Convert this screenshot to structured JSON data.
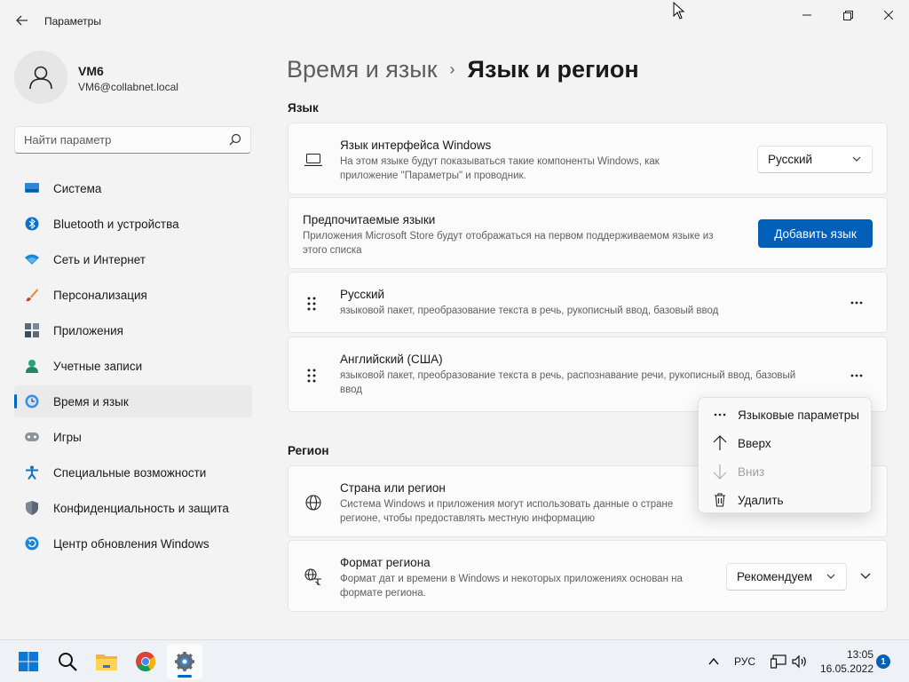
{
  "window": {
    "title": "Параметры",
    "back_label": "←"
  },
  "profile": {
    "name": "VM6",
    "email": "VM6@collabnet.local"
  },
  "search": {
    "placeholder": "Найти параметр"
  },
  "sidebar": {
    "items": [
      {
        "label": "Система",
        "icon": "system-icon",
        "active": false
      },
      {
        "label": "Bluetooth и устройства",
        "icon": "bluetooth-icon",
        "active": false
      },
      {
        "label": "Сеть и Интернет",
        "icon": "wifi-icon",
        "active": false
      },
      {
        "label": "Персонализация",
        "icon": "brush-icon",
        "active": false
      },
      {
        "label": "Приложения",
        "icon": "apps-icon",
        "active": false
      },
      {
        "label": "Учетные записи",
        "icon": "accounts-icon",
        "active": false
      },
      {
        "label": "Время и язык",
        "icon": "time-language-icon",
        "active": true
      },
      {
        "label": "Игры",
        "icon": "gaming-icon",
        "active": false
      },
      {
        "label": "Специальные возможности",
        "icon": "accessibility-icon",
        "active": false
      },
      {
        "label": "Конфиденциальность и защита",
        "icon": "shield-icon",
        "active": false
      },
      {
        "label": "Центр обновления Windows",
        "icon": "update-icon",
        "active": false
      }
    ]
  },
  "breadcrumb": {
    "parent": "Время и язык",
    "separator": "›",
    "current": "Язык и регион"
  },
  "language_section": {
    "title": "Язык",
    "display_language": {
      "title": "Язык интерфейса Windows",
      "desc": "На этом языке будут показываться такие компоненты Windows, как приложение \"Параметры\" и проводник.",
      "value": "Русский"
    },
    "preferred": {
      "title": "Предпочитаемые языки",
      "desc": "Приложения Microsoft Store будут отображаться на первом поддерживаемом языке из этого списка",
      "button": "Добавить язык"
    },
    "languages": [
      {
        "name": "Русский",
        "features": "языковой пакет, преобразование текста в речь, рукописный ввод, базовый ввод"
      },
      {
        "name": "Английский (США)",
        "features": "языковой пакет, преобразование текста в речь, распознавание речи, рукописный ввод, базовый ввод"
      }
    ]
  },
  "region_section": {
    "title": "Регион",
    "country": {
      "title": "Страна или регион",
      "desc": "Система Windows и приложения могут использовать данные о стране регионе, чтобы предоставлять местную информацию"
    },
    "format": {
      "title": "Формат региона",
      "desc": "Формат дат и времени в Windows и некоторых приложениях основан на формате региона.",
      "value": "Рекомендуем"
    }
  },
  "context_menu": {
    "items": [
      {
        "label": "Языковые параметры",
        "icon": "more-icon",
        "disabled": false
      },
      {
        "label": "Вверх",
        "icon": "arrow-up-icon",
        "disabled": false
      },
      {
        "label": "Вниз",
        "icon": "arrow-down-icon",
        "disabled": true
      },
      {
        "label": "Удалить",
        "icon": "trash-icon",
        "disabled": false
      }
    ]
  },
  "taskbar": {
    "apps": [
      "start-icon",
      "search-icon",
      "file-explorer-icon",
      "chrome-icon",
      "settings-icon"
    ],
    "input_lang": "РУС",
    "time": "13:05",
    "date": "16.05.2022",
    "notifications": "1"
  },
  "colors": {
    "accent": "#005fb8",
    "background": "#f3f3f3",
    "card": "#fbfbfb"
  }
}
